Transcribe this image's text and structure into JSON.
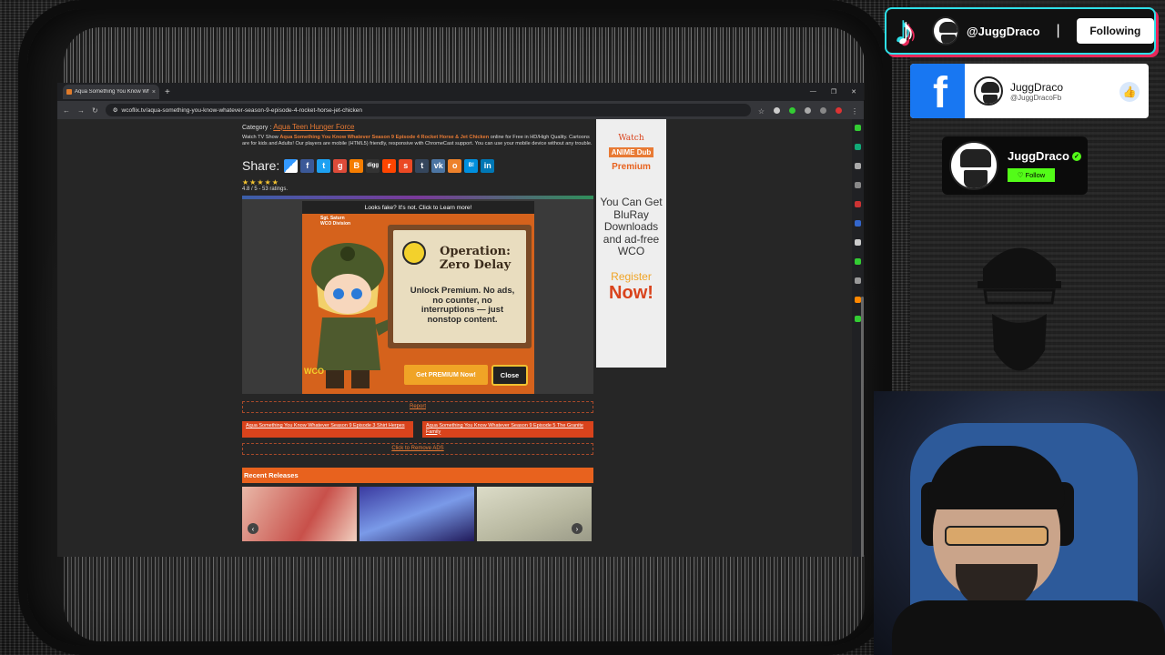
{
  "browser": {
    "tab_title": "Aqua Something You Know Wh",
    "tab_close": "×",
    "new_tab": "+",
    "url": "wcoflix.tv/aqua-something-you-know-whatever-season-9-episode-4-rocket-horse-jet-chicken"
  },
  "page": {
    "category_label": "Category :",
    "category_link": "Aqua Teen Hunger Force",
    "desc_prefix": "Watch TV Show",
    "desc_title": "Aqua Something You Know Whatever Season 9 Episode 4 Rocket Horse & Jet Chicken",
    "desc_suffix": "online for Free in HD/High Quality. Cartoons are for kids and Adults! Our players are mobile (HTML5) friendly, responsive with ChromeCast support. You can use your mobile device without any trouble.",
    "share_label": "Share:",
    "share_icons": [
      "delicious-icon",
      "facebook-icon",
      "twitter-icon",
      "google-icon",
      "blogger-icon",
      "digg-icon",
      "reddit-icon",
      "stumbleupon-icon",
      "tumblr-icon",
      "vk-icon",
      "odnoklassniki-icon",
      "hatena-icon",
      "linkedin-icon"
    ],
    "stars": "★★★★★",
    "rating": "4.8 / 5 - 53 ratings.",
    "report": "Report",
    "prev_episode": "Aqua Something You Know Whatever Season 9 Episode 3 Shirt Herpes",
    "next_episode": "Aqua Something You Know Whatever Season 9 Episode 5 The Granite Family",
    "remove_ads": "Click to Remove ADS",
    "recent_releases": "Recent Releases"
  },
  "popup": {
    "top_text": "Looks fake? It's not. Click to Learn more!",
    "badge_line1": "Sgt. Saturn",
    "badge_line2": "WCO Division",
    "title": "Operation: Zero Delay",
    "body": "Unlock Premium. No ads, no counter, no interruptions — just nonstop content.",
    "cta": "Get PREMIUM Now!",
    "close": "Close",
    "brand": "WCO"
  },
  "side_ad": {
    "watch": "Watch",
    "anime": "ANIME",
    "dub": "Dub",
    "premium": "Premium",
    "text": "You Can Get BluRay Downloads and ad-free WCO",
    "register": "Register",
    "now": "Now!"
  },
  "tiktok": {
    "handle": "@JuggDraco",
    "separator": "|",
    "button": "Following"
  },
  "facebook": {
    "name": "JuggDraco",
    "handle": "@JuggDracoFb"
  },
  "kick": {
    "name": "JuggDraco",
    "button": "Follow"
  },
  "colors": {
    "accent_orange": "#e8621e",
    "facebook_blue": "#1877f2",
    "kick_green": "#53fc18",
    "tiktok_cyan": "#2de0e8",
    "tiktok_pink": "#e8285a"
  }
}
